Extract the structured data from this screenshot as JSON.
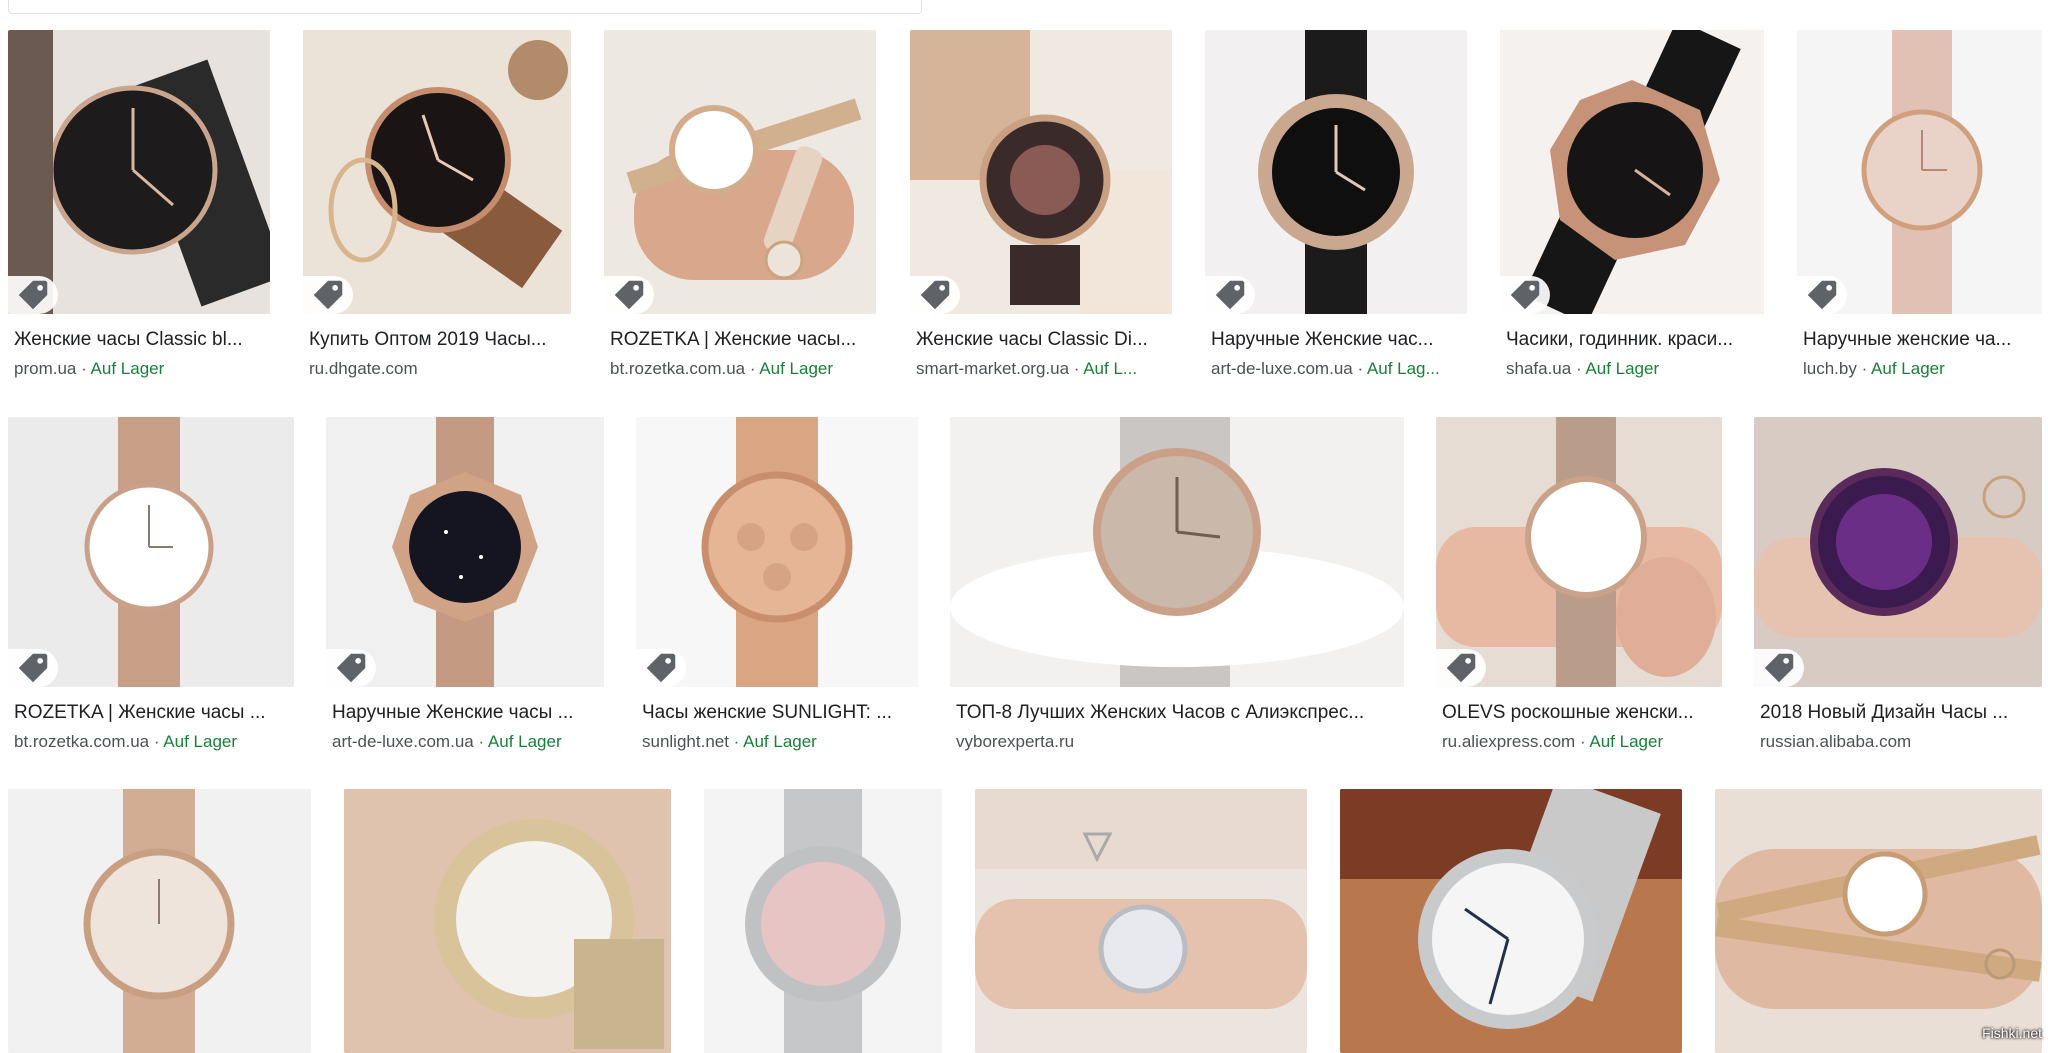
{
  "colors": {
    "caption": "#202124",
    "source": "#4d5156",
    "stock": "#188038"
  },
  "icons": {
    "tag": "tag-icon"
  },
  "watermark": "Fishki.net",
  "rows": [
    {
      "results": [
        {
          "title": "Женские часы Classic bl...",
          "source": "prom.ua",
          "stock": "Auf Lager"
        },
        {
          "title": "Купить Оптом 2019 Часы...",
          "source": "ru.dhgate.com",
          "stock": ""
        },
        {
          "title": "ROZETKA | Женские часы...",
          "source": "bt.rozetka.com.ua",
          "stock": "Auf Lager"
        },
        {
          "title": "Женские часы Classic Di...",
          "source": "smart-market.org.ua",
          "stock": "Auf L..."
        },
        {
          "title": "Наручные Женские час...",
          "source": "art-de-luxe.com.ua",
          "stock": "Auf Lag..."
        },
        {
          "title": "Часики, годинник. краси...",
          "source": "shafa.ua",
          "stock": "Auf Lager"
        },
        {
          "title": "Наручные женские ча...",
          "source": "luch.by",
          "stock": "Auf Lager"
        }
      ]
    },
    {
      "results": [
        {
          "title": "ROZETKA | Женские часы ...",
          "source": "bt.rozetka.com.ua",
          "stock": "Auf Lager"
        },
        {
          "title": "Наручные Женские часы ...",
          "source": "art-de-luxe.com.ua",
          "stock": "Auf Lager"
        },
        {
          "title": "Часы женские SUNLIGHT: ...",
          "source": "sunlight.net",
          "stock": "Auf Lager"
        },
        {
          "title": "ТОП-8 Лучших Женских Часов с Алиэкспрес...",
          "source": "vyborexperta.ru",
          "stock": ""
        },
        {
          "title": "OLEVS роскошные женски...",
          "source": "ru.aliexpress.com",
          "stock": "Auf Lager"
        },
        {
          "title": "2018 Новый Дизайн Часы ...",
          "source": "russian.alibaba.com",
          "stock": ""
        }
      ]
    },
    {
      "results": [
        {
          "title": "",
          "source": "",
          "stock": ""
        },
        {
          "title": "",
          "source": "",
          "stock": ""
        },
        {
          "title": "",
          "source": "",
          "stock": ""
        },
        {
          "title": "",
          "source": "",
          "stock": ""
        },
        {
          "title": "",
          "source": "",
          "stock": ""
        },
        {
          "title": "",
          "source": "",
          "stock": ""
        }
      ]
    }
  ]
}
